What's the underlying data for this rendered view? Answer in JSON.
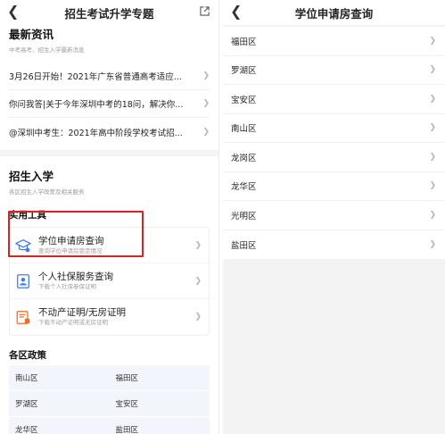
{
  "left": {
    "header": {
      "title": "招生考试升学专题"
    },
    "news": {
      "title": "最新资讯",
      "subtitle": "中考高考、招生入学最新消息",
      "items": [
        "3月26日开始！2021年广东省普通高考适应...",
        "你问我答|关于今年深圳中考的18问，解决你...",
        "@深圳中考生：2021年高中阶段学校考试招..."
      ]
    },
    "admission": {
      "title": "招生入学",
      "subtitle": "各区招生入学政策及相关服务"
    },
    "tools": {
      "title": "实用工具",
      "items": [
        {
          "title": "学位申请房查询",
          "subtitle": "查询学位申请房锁定情况",
          "icon": "graduation-cap-icon"
        },
        {
          "title": "个人社保服务查询",
          "subtitle": "下载个人社保参保证明",
          "icon": "id-card-icon"
        },
        {
          "title": "不动产证明/无房证明",
          "subtitle": "下载不动产证明或无房证明",
          "icon": "certificate-icon"
        }
      ]
    },
    "policies": {
      "title": "各区政策",
      "districts": [
        "南山区",
        "福田区",
        "罗湖区",
        "宝安区",
        "龙华区",
        "盐田区"
      ]
    }
  },
  "right": {
    "header": {
      "title": "学位申请房查询"
    },
    "districts": [
      "福田区",
      "罗湖区",
      "宝安区",
      "南山区",
      "龙岗区",
      "龙华区",
      "光明区",
      "盐田区"
    ]
  },
  "colors": {
    "accent_blue": "#3d7df0",
    "highlight_red": "#e02020",
    "icon_orange": "#ef6a2c"
  }
}
